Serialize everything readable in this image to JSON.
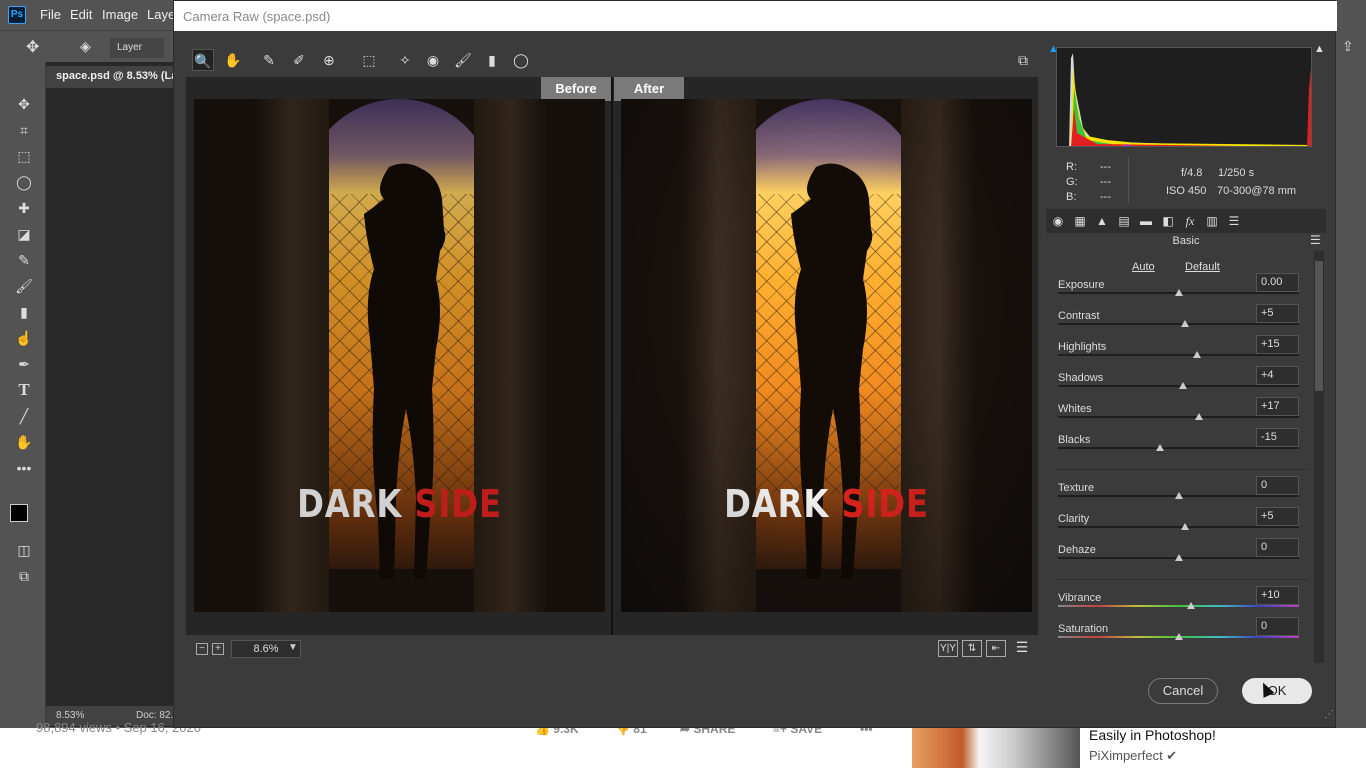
{
  "ps": {
    "logo": "Ps",
    "menu": [
      "File",
      "Edit",
      "Image",
      "Layer"
    ],
    "layer_select": "Layer",
    "doc_tab": "space.psd @ 8.53% (La",
    "status_zoom": "8.53%",
    "status_doc": "Doc: 82."
  },
  "dialog": {
    "title": "Camera Raw (space.psd)",
    "before_label": "Before",
    "after_label": "After",
    "photo_title_white": "DARK",
    "photo_title_red": "SIDE",
    "zoom_value": "8.6%",
    "zoom_minus": "−",
    "zoom_plus": "+",
    "info": {
      "r_label": "R:",
      "r_value": "---",
      "g_label": "G:",
      "g_value": "---",
      "b_label": "B:",
      "b_value": "---",
      "aperture": "f/4.8",
      "shutter": "1/250 s",
      "iso": "ISO 450",
      "lens": "70-300@78 mm"
    },
    "panel_title": "Basic",
    "auto_label": "Auto",
    "default_label": "Default",
    "sliders": [
      {
        "label": "Exposure",
        "value": "0.00",
        "pos": 0.5
      },
      {
        "label": "Contrast",
        "value": "+5",
        "pos": 0.525
      },
      {
        "label": "Highlights",
        "value": "+15",
        "pos": 0.575
      },
      {
        "label": "Shadows",
        "value": "+4",
        "pos": 0.52
      },
      {
        "label": "Whites",
        "value": "+17",
        "pos": 0.585
      },
      {
        "label": "Blacks",
        "value": "-15",
        "pos": 0.425
      },
      {
        "label": "Texture",
        "value": "0",
        "pos": 0.5
      },
      {
        "label": "Clarity",
        "value": "+5",
        "pos": 0.525
      },
      {
        "label": "Dehaze",
        "value": "0",
        "pos": 0.5
      },
      {
        "label": "Vibrance",
        "value": "+10",
        "pos": 0.55
      },
      {
        "label": "Saturation",
        "value": "0",
        "pos": 0.5
      }
    ],
    "cancel_label": "Cancel",
    "ok_label": "OK"
  },
  "youtube": {
    "views": "98,894 views • Sep 16, 2020",
    "likes": "9.3K",
    "dislikes": "81",
    "share": "SHARE",
    "save": "SAVE",
    "more": "•••",
    "video_title": "Easily in Photoshop!",
    "channel": "PiXimperfect ✔"
  }
}
